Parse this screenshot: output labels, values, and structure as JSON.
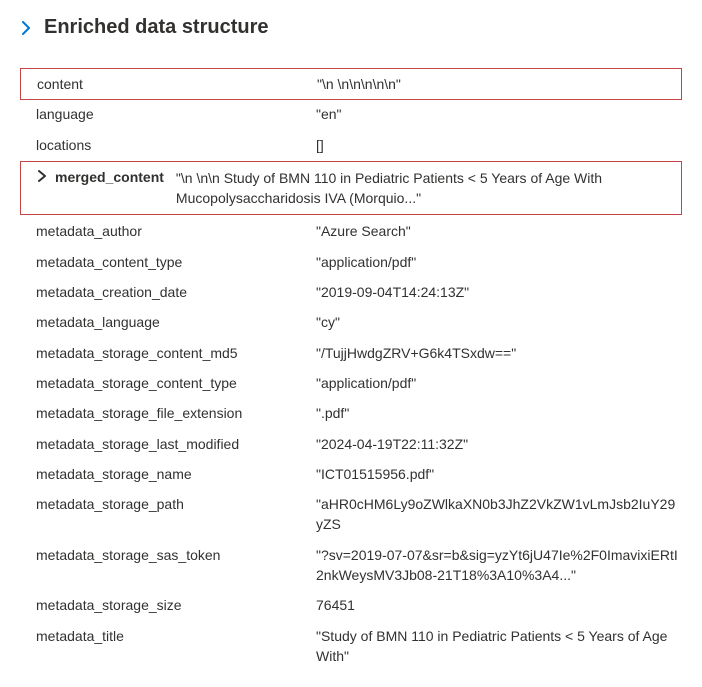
{
  "header": {
    "title": "Enriched data structure"
  },
  "rows": [
    {
      "key": "content",
      "val": "\"\\n \\n\\n\\n\\n\\n\"",
      "boxed": true
    },
    {
      "key": "language",
      "val": "\"en\""
    },
    {
      "key": "locations",
      "val": "[]"
    }
  ],
  "merged_content": {
    "key": "merged_content",
    "val": "\"\\n \\n\\n Study of BMN 110 in Pediatric Patients < 5 Years of Age With Mucopolysaccharidosis IVA (Morquio...\""
  },
  "rows2": [
    {
      "key": "metadata_author",
      "val": "\"Azure Search\""
    },
    {
      "key": "metadata_content_type",
      "val": "\"application/pdf\""
    },
    {
      "key": "metadata_creation_date",
      "val": "\"2019-09-04T14:24:13Z\""
    },
    {
      "key": "metadata_language",
      "val": "\"cy\""
    },
    {
      "key": "metadata_storage_content_md5",
      "val": "\"/TujjHwdgZRV+G6k4TSxdw==\""
    },
    {
      "key": "metadata_storage_content_type",
      "val": "\"application/pdf\""
    },
    {
      "key": "metadata_storage_file_extension",
      "val": "\".pdf\""
    },
    {
      "key": "metadata_storage_last_modified",
      "val": "\"2024-04-19T22:11:32Z\""
    },
    {
      "key": "metadata_storage_name",
      "val": "\"ICT01515956.pdf\""
    },
    {
      "key": "metadata_storage_path",
      "val": "\"aHR0cHM6Ly9oZWlkaXN0b3JhZ2VkZW1vLmJsb2IuY29yZS"
    },
    {
      "key": "metadata_storage_sas_token",
      "val": "\"?sv=2019-07-07&sr=b&sig=yzYt6jU47Ie%2F0ImavixiERtI2nkWeysMV3Jb08-21T18%3A10%3A4...\""
    },
    {
      "key": "metadata_storage_size",
      "val": "76451"
    },
    {
      "key": "metadata_title",
      "val": "\"Study of BMN 110 in Pediatric Patients < 5 Years of Age With\""
    }
  ]
}
